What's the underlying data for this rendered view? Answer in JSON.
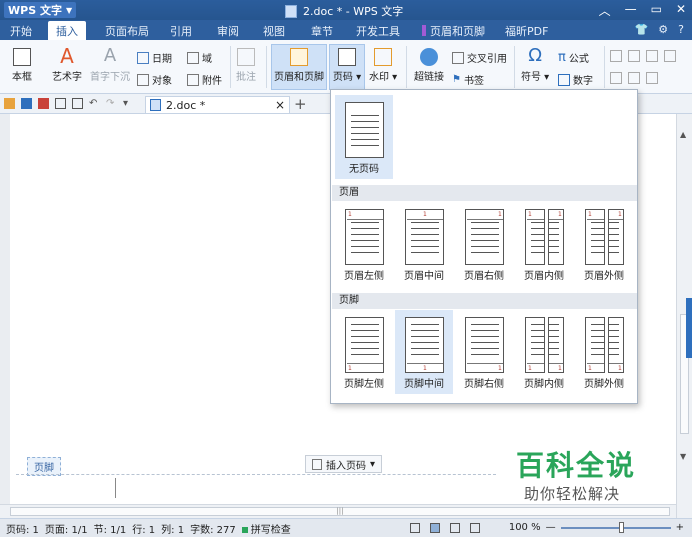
{
  "app": {
    "logo_text": "WPS 文字",
    "window_title": "2.doc * - WPS 文字"
  },
  "menu": {
    "tabs": [
      "开始",
      "插入",
      "页面布局",
      "引用",
      "审阅",
      "视图",
      "章节",
      "开发工具",
      "页眉和页脚",
      "福昕PDF"
    ],
    "active": "插入",
    "right_icons": [
      "skin-icon",
      "settings-icon",
      "help"
    ],
    "help_label": "?"
  },
  "ribbon": {
    "textbox": "本框",
    "wordart": "艺术字",
    "dropcap": "首字下沉",
    "date": "日期",
    "field": "域",
    "object": "对象",
    "attachment": "附件",
    "comment": "批注",
    "header_footer": "页眉和页脚",
    "page_number": "页码",
    "watermark": "水印",
    "hyperlink": "超链接",
    "cross_ref": "交叉引用",
    "bookmark": "书签",
    "symbol": "符号",
    "formula": "公式",
    "number": "数字"
  },
  "doctab": {
    "name": "2.doc *"
  },
  "panel": {
    "no_page_number": "无页码",
    "header_section": "页眉",
    "footer_section": "页脚",
    "header_items": [
      "页眉左侧",
      "页眉中间",
      "页眉右侧",
      "页眉内侧",
      "页眉外侧"
    ],
    "footer_items": [
      "页脚左侧",
      "页脚中间",
      "页脚右侧",
      "页脚内侧",
      "页脚外侧"
    ],
    "selected_footer": "页脚中间",
    "page_num_char": "1"
  },
  "document": {
    "footer_label": "页脚",
    "insert_page_number": "插入页码"
  },
  "watermark": {
    "line1": "百科全说",
    "line2": "助你轻松解决"
  },
  "statusbar": {
    "page": "页码: 1",
    "pages": "页面: 1/1",
    "section": "节: 1/1",
    "row": "行: 1",
    "col": "列: 1",
    "words": "字数: 277",
    "spell": "拼写检查",
    "zoom": "100 %",
    "zoom_fraction": 0.56
  },
  "colors": {
    "title_blue": "#2b5d9c",
    "accent_green": "#2aa55a",
    "header_purple": "#a25bd5",
    "selection_blue": "#dbe8f8"
  }
}
